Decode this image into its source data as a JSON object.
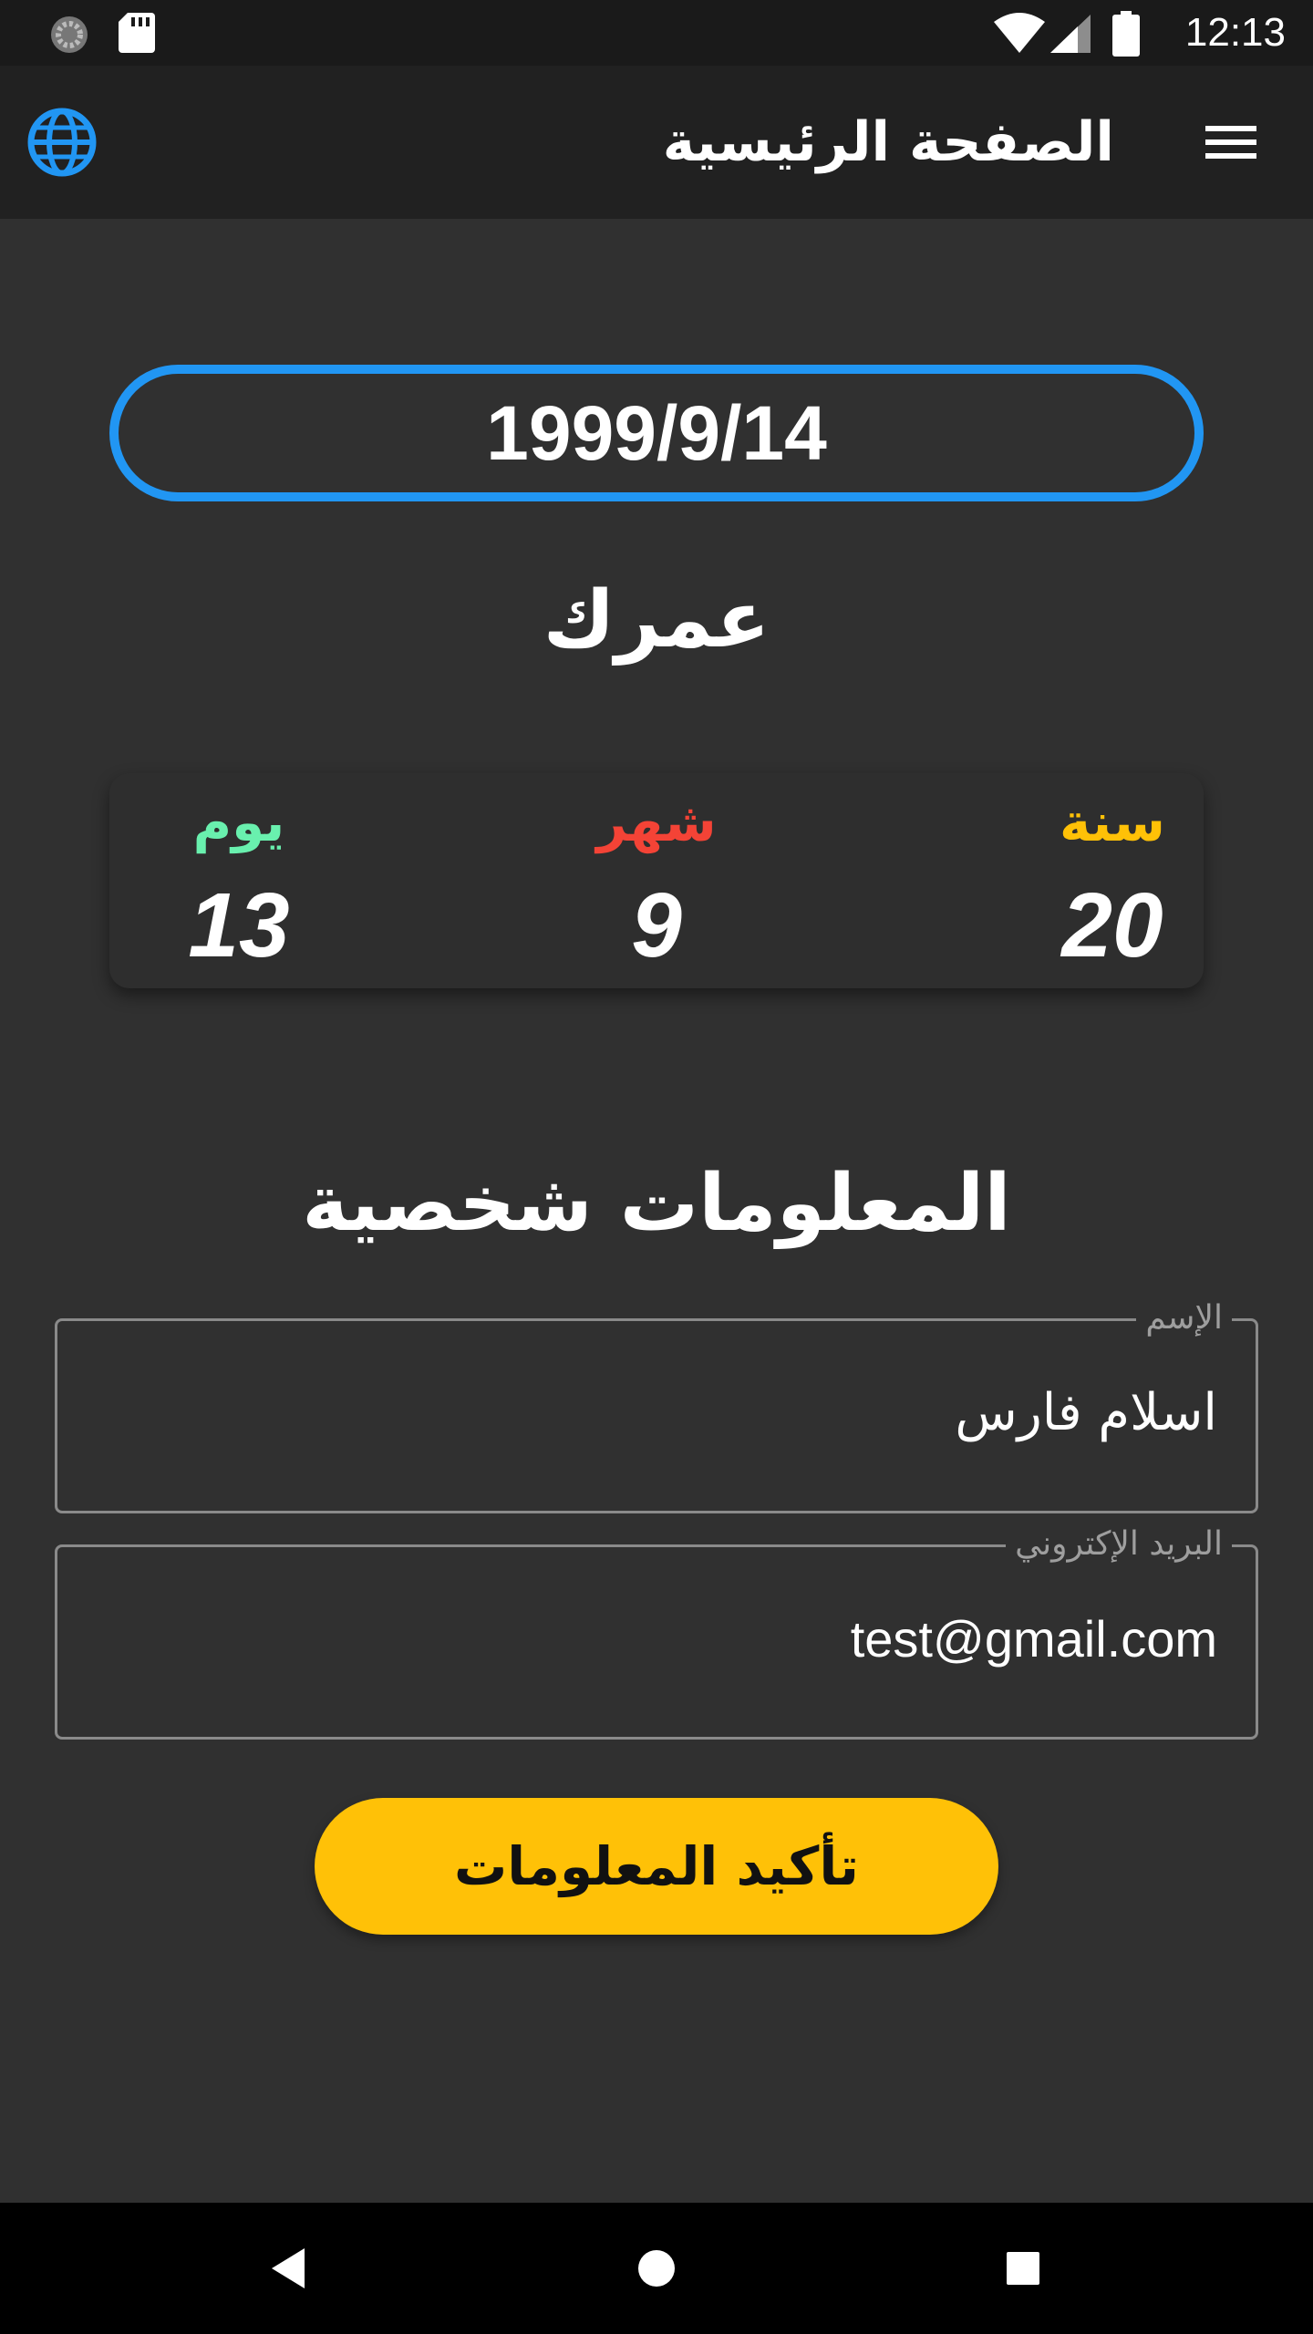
{
  "status_bar": {
    "time": "12:13"
  },
  "app_bar": {
    "title": "الصفحة الرئيسية"
  },
  "birth_date": {
    "value": "1999/9/14"
  },
  "age": {
    "title": "عمرك",
    "years": {
      "label": "سنة",
      "value": "20",
      "color": "#ffc107"
    },
    "months": {
      "label": "شهر",
      "value": "9",
      "color": "#f44336"
    },
    "days": {
      "label": "يوم",
      "value": "13",
      "color": "#69f0ae"
    }
  },
  "personal_info": {
    "title": "المعلومات شخصية",
    "name_field": {
      "label": "الإسم",
      "value": "اسلام فارس"
    },
    "email_field": {
      "label": "البريد الإكتروني",
      "value": "test@gmail.com"
    },
    "confirm_label": "تأكيد المعلومات"
  },
  "colors": {
    "accent": "#2196f3",
    "button": "#ffc107",
    "background": "#303030",
    "app_bar": "#212121"
  }
}
